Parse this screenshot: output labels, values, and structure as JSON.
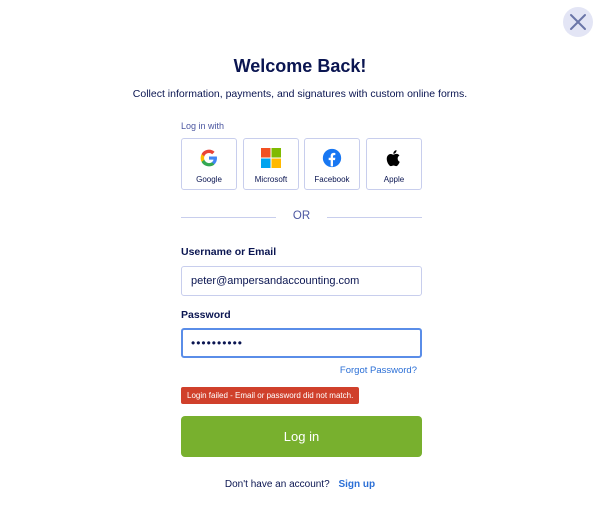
{
  "header": {
    "title": "Welcome Back!",
    "subtitle": "Collect information, payments, and signatures with custom online forms.",
    "close_icon": "close-icon"
  },
  "social": {
    "heading": "Log in with",
    "providers": [
      {
        "label": "Google",
        "icon": "google-icon"
      },
      {
        "label": "Microsoft",
        "icon": "microsoft-icon"
      },
      {
        "label": "Facebook",
        "icon": "facebook-icon"
      },
      {
        "label": "Apple",
        "icon": "apple-icon"
      }
    ]
  },
  "divider": {
    "text": "OR"
  },
  "form": {
    "username_label": "Username or Email",
    "username_value": "peter@ampersandaccounting.com",
    "password_label": "Password",
    "password_value": "••••••••••",
    "forgot_label": "Forgot Password?",
    "error_message": "Login failed - Email or password did not match.",
    "submit_label": "Log in"
  },
  "footer": {
    "prompt": "Don't have an account?",
    "signup_label": "Sign up"
  },
  "colors": {
    "primary_text": "#0a1551",
    "accent_link": "#2b6fd6",
    "button_green": "#78b02e",
    "error_red": "#d0402b",
    "focus_blue": "#5a8de8"
  }
}
